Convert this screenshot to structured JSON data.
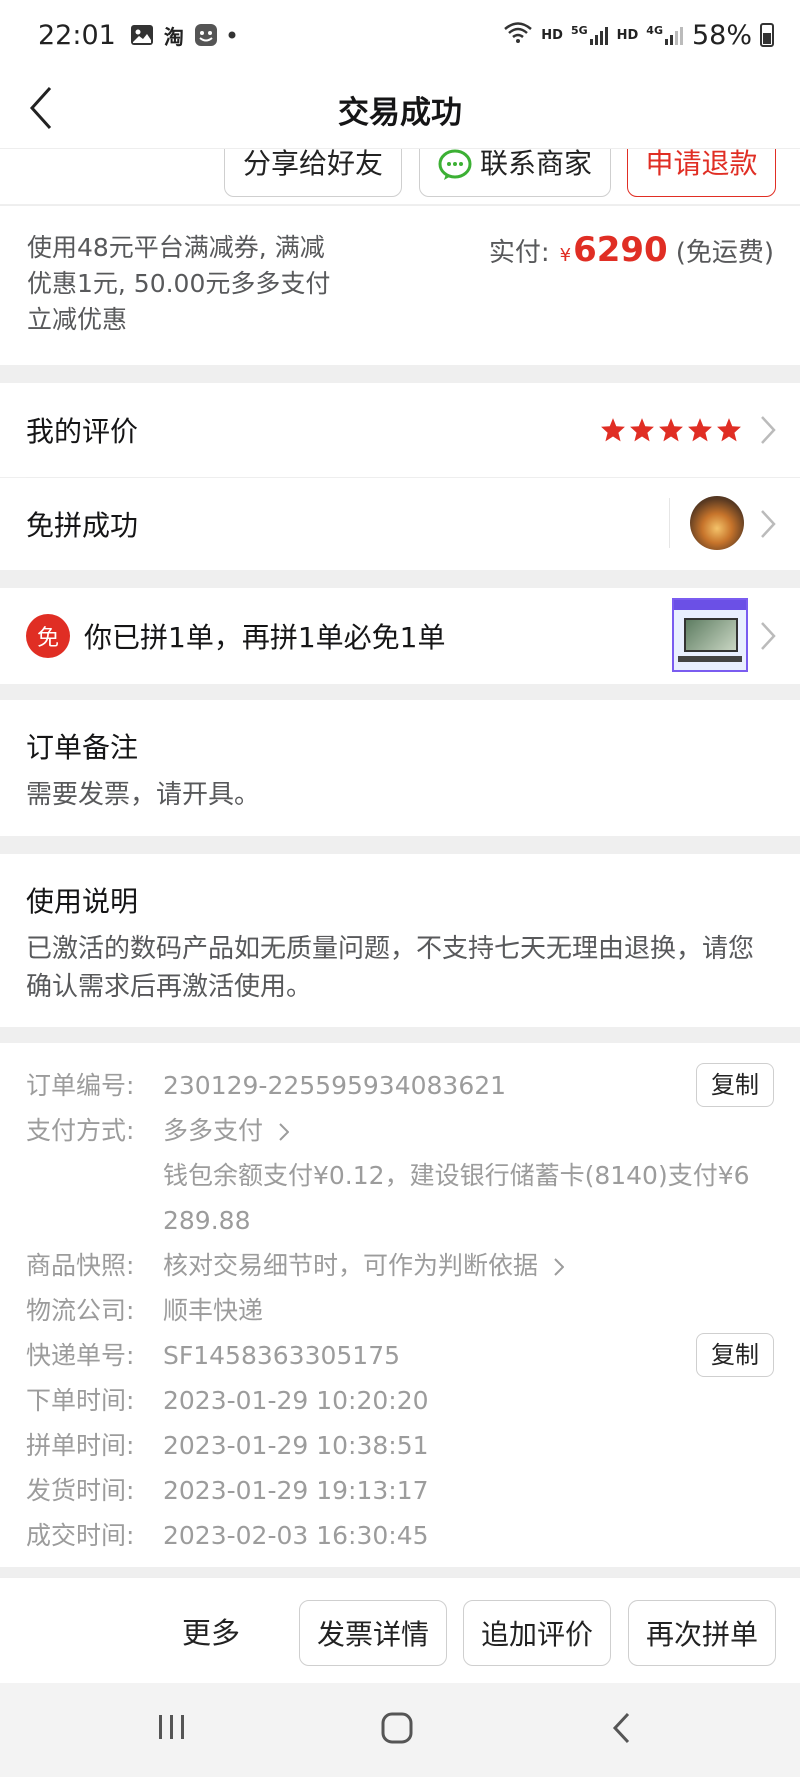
{
  "status_bar": {
    "time": "22:01",
    "app_icons": [
      "image-icon",
      "taobao-icon",
      "wechat-like-icon",
      "dot"
    ],
    "taobao_glyph": "淘",
    "network_label_1": "HD",
    "network_5g": "5G",
    "network_label_2": "HD",
    "network_4g": "4G",
    "battery": "58%"
  },
  "nav": {
    "title": "交易成功"
  },
  "action_strip": {
    "share": "分享给好友",
    "contact": "联系商家",
    "refund": "申请退款"
  },
  "payment": {
    "description": "使用48元平台满减券, 满减优惠1元, 50.00元多多支付立减优惠",
    "paid_label": "实付:",
    "currency": "¥",
    "amount": "6290",
    "shipping": "(免运费)",
    "accent_color": "#e02e24"
  },
  "review": {
    "label": "我的评价",
    "rating": 5
  },
  "group": {
    "label": "免拼成功"
  },
  "promo": {
    "badge": "免",
    "text": "你已拼1单，再拼1单必免1单"
  },
  "note": {
    "title": "订单备注",
    "text": "需要发票，请开具。"
  },
  "usage": {
    "title": "使用说明",
    "text": "已激活的数码产品如无质量问题，不支持七天无理由退换，请您确认需求后再激活使用。"
  },
  "order_info": {
    "order_no_label": "订单编号:",
    "order_no": "230129-225595934083621",
    "copy": "复制",
    "pay_method_label": "支付方式:",
    "pay_method": "多多支付",
    "pay_detail_1": "钱包余额支付¥0.12，建设银行储蓄卡(8140)支付¥6",
    "pay_detail_2": "289.88",
    "snapshot_label": "商品快照:",
    "snapshot": "核对交易细节时，可作为判断依据",
    "logistics_label": "物流公司:",
    "logistics": "顺丰快递",
    "tracking_label": "快递单号:",
    "tracking": "SF1458363305175",
    "order_time_label": "下单时间:",
    "order_time": "2023-01-29 10:20:20",
    "group_time_label": "拼单时间:",
    "group_time": "2023-01-29 10:38:51",
    "ship_time_label": "发货时间:",
    "ship_time": "2023-01-29 19:13:17",
    "deal_time_label": "成交时间:",
    "deal_time": "2023-02-03 16:30:45"
  },
  "bottom_bar": {
    "more": "更多",
    "invoice": "发票详情",
    "add_review": "追加评价",
    "rebuy": "再次拼单"
  }
}
